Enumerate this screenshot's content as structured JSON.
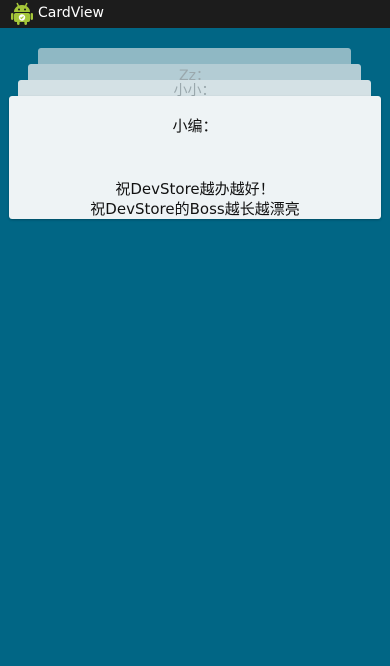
{
  "app": {
    "title": "CardView",
    "icon": "android-robot-icon"
  },
  "colors": {
    "background": "#016685",
    "action_bar": "#1c1c1c",
    "card_front": "#eef3f5"
  },
  "cards": {
    "back": [
      {
        "label": ""
      },
      {
        "label": "Zz："
      },
      {
        "label": "小小："
      }
    ],
    "front": {
      "title": "小编：",
      "lines": [
        "祝DevStore越办越好！",
        "祝DevStore的Boss越长越漂亮"
      ]
    }
  }
}
